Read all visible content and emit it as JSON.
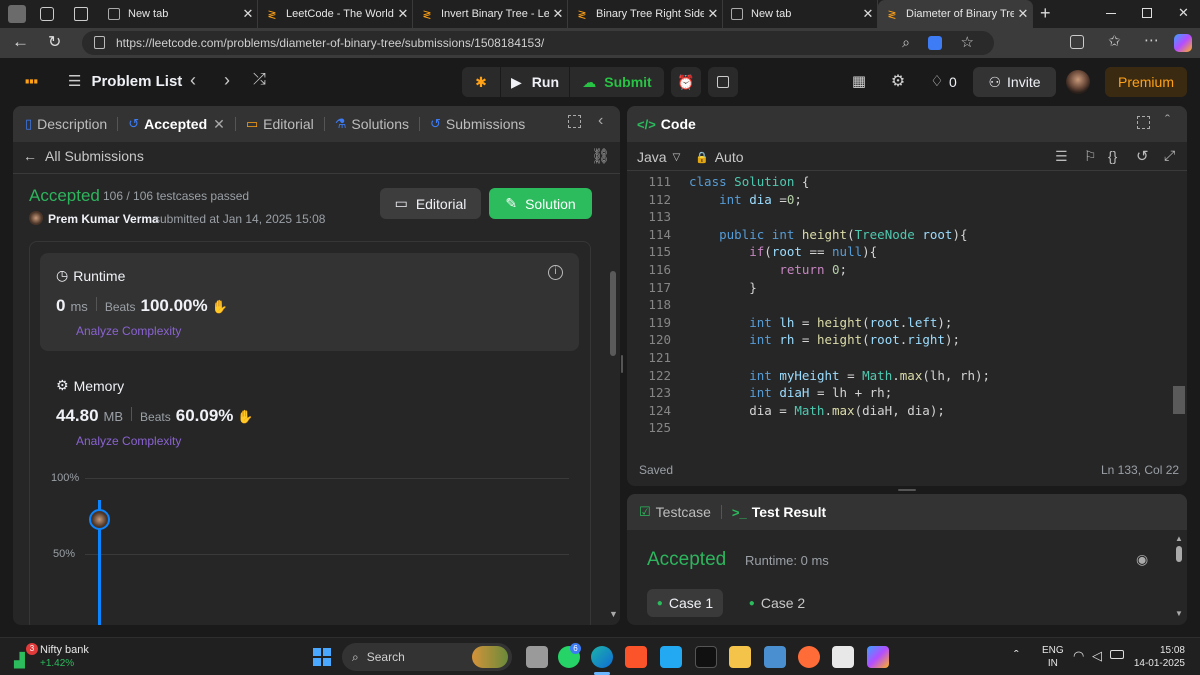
{
  "browser": {
    "tabs": [
      {
        "title": "New tab",
        "active": false
      },
      {
        "title": "LeetCode - The World's Le",
        "active": false
      },
      {
        "title": "Invert Binary Tree - LeetC",
        "active": false
      },
      {
        "title": "Binary Tree Right Side Vie",
        "active": false
      },
      {
        "title": "New tab",
        "active": false
      },
      {
        "title": "Diameter of Binary Tree -",
        "active": true
      }
    ],
    "url": "https://leetcode.com/problems/diameter-of-binary-tree/submissions/1508184153/"
  },
  "header": {
    "problem_list": "Problem List",
    "run": "Run",
    "submit": "Submit",
    "streak": "0",
    "invite": "Invite",
    "premium": "Premium"
  },
  "left_tabs": {
    "description": "Description",
    "accepted": "Accepted",
    "editorial": "Editorial",
    "solutions": "Solutions",
    "submissions": "Submissions"
  },
  "submission": {
    "back": "All Submissions",
    "status": "Accepted",
    "testcases": "106 / 106 testcases passed",
    "user": "Prem Kumar Verma",
    "submitted_at": "submitted at Jan 14, 2025 15:08",
    "editorial_btn": "Editorial",
    "solution_btn": "Solution"
  },
  "runtime": {
    "label": "Runtime",
    "value": "0",
    "unit": "ms",
    "beats_label": "Beats",
    "beats": "100.00%",
    "analyze": "Analyze Complexity"
  },
  "memory": {
    "label": "Memory",
    "value": "44.80",
    "unit": "MB",
    "beats_label": "Beats",
    "beats": "60.09%",
    "analyze": "Analyze Complexity"
  },
  "chart_labels": {
    "top": "100%",
    "mid": "50%"
  },
  "code_panel": {
    "title": "Code",
    "language": "Java",
    "mode": "Auto",
    "saved": "Saved",
    "position": "Ln 133, Col 22",
    "lines": [
      {
        "n": "111",
        "t": "class Solution {"
      },
      {
        "n": "112",
        "t": "    int dia =0;"
      },
      {
        "n": "113",
        "t": ""
      },
      {
        "n": "114",
        "t": "    public int height(TreeNode root){"
      },
      {
        "n": "115",
        "t": "        if(root == null){"
      },
      {
        "n": "116",
        "t": "            return 0;"
      },
      {
        "n": "117",
        "t": "        }"
      },
      {
        "n": "118",
        "t": ""
      },
      {
        "n": "119",
        "t": "        int lh = height(root.left);"
      },
      {
        "n": "120",
        "t": "        int rh = height(root.right);"
      },
      {
        "n": "121",
        "t": ""
      },
      {
        "n": "122",
        "t": "        int myHeight = Math.max(lh, rh);"
      },
      {
        "n": "123",
        "t": "        int diaH = lh + rh;"
      },
      {
        "n": "124",
        "t": "        dia = Math.max(diaH, dia);"
      },
      {
        "n": "125",
        "t": ""
      }
    ]
  },
  "test_panel": {
    "testcase_tab": "Testcase",
    "result_tab": "Test Result",
    "status": "Accepted",
    "runtime": "Runtime: 0 ms",
    "case1": "Case 1",
    "case2": "Case 2"
  },
  "taskbar": {
    "stock_name": "Nifty bank",
    "stock_change": "+1.42%",
    "stock_badge": "3",
    "search": "Search",
    "lang": "ENG",
    "region": "IN",
    "time": "15:08",
    "date": "14-01-2025",
    "whatsapp_badge": "6"
  },
  "colors": {
    "accent_green": "#2cbb5d",
    "submit_green": "#28c244",
    "accepted_green": "#2db55d",
    "premium_orange": "#ffa116",
    "link_purple": "#8a63d2",
    "chart_blue": "#0a84ff"
  }
}
